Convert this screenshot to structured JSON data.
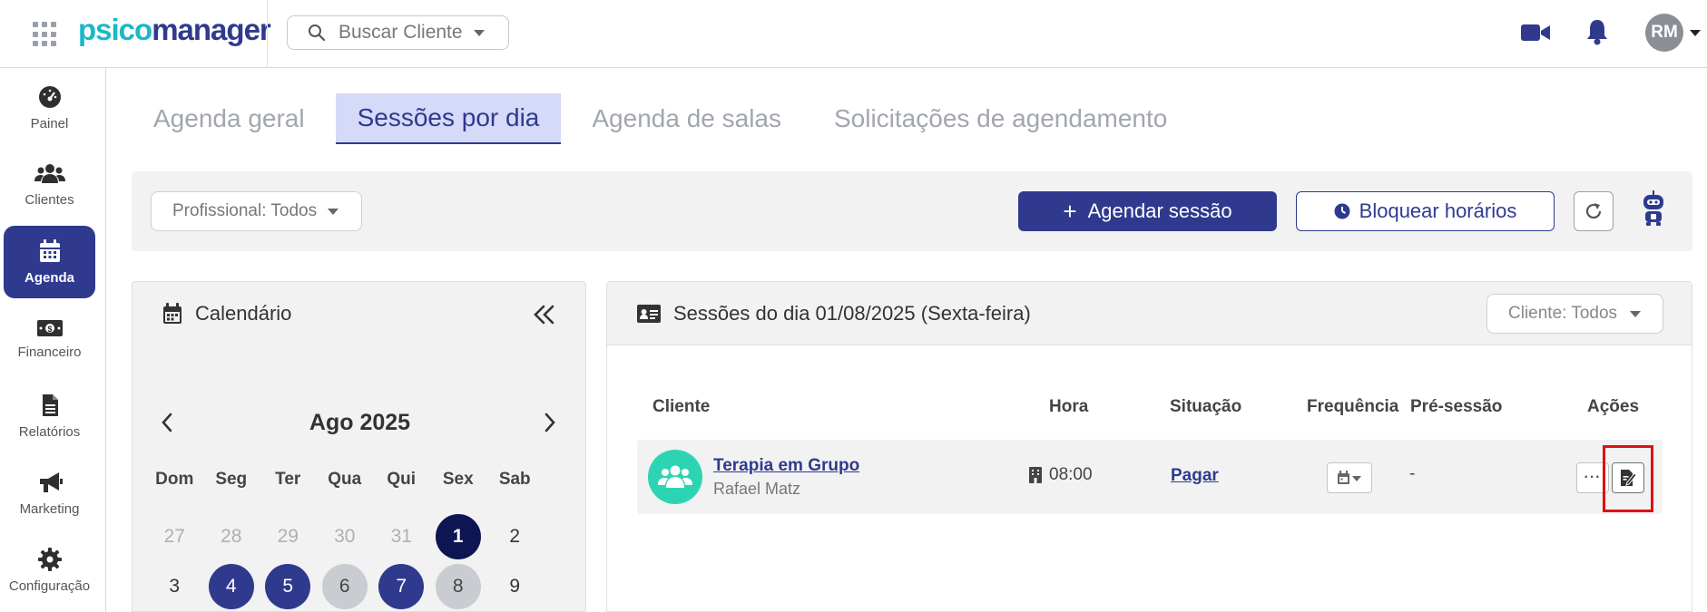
{
  "header": {
    "logo_part1": "psico",
    "logo_part2": "manager",
    "search_placeholder": "Buscar Cliente",
    "avatar_initials": "RM",
    "icons": [
      "apps-grid-icon",
      "search-icon",
      "video-camera-icon",
      "bell-icon"
    ]
  },
  "sidebar": {
    "items": [
      {
        "label": "Painel",
        "icon": "dashboard-gauge-icon"
      },
      {
        "label": "Clientes",
        "icon": "users-icon"
      },
      {
        "label": "Agenda",
        "icon": "calendar-icon",
        "active": true
      },
      {
        "label": "Financeiro",
        "icon": "money-icon"
      },
      {
        "label": "Relatórios",
        "icon": "document-icon"
      },
      {
        "label": "Marketing",
        "icon": "megaphone-icon"
      },
      {
        "label": "Configuração",
        "icon": "gear-icon"
      }
    ]
  },
  "tabs": [
    {
      "label": "Agenda geral"
    },
    {
      "label": "Sessões por dia",
      "active": true
    },
    {
      "label": "Agenda de salas"
    },
    {
      "label": "Solicitações de agendamento"
    }
  ],
  "toolbar": {
    "professional_filter": "Profissional: Todos",
    "schedule_button": "Agendar sessão",
    "block_button": "Bloquear horários"
  },
  "calendar": {
    "title": "Calendário",
    "month_label": "Ago 2025",
    "weekdays": [
      "Dom",
      "Seg",
      "Ter",
      "Qua",
      "Qui",
      "Sex",
      "Sab"
    ],
    "days": [
      {
        "n": "27",
        "state": "out"
      },
      {
        "n": "28",
        "state": "out"
      },
      {
        "n": "29",
        "state": "out"
      },
      {
        "n": "30",
        "state": "out"
      },
      {
        "n": "31",
        "state": "out"
      },
      {
        "n": "1",
        "state": "today"
      },
      {
        "n": "2",
        "state": "normal"
      },
      {
        "n": "3",
        "state": "normal"
      },
      {
        "n": "4",
        "state": "booked"
      },
      {
        "n": "5",
        "state": "booked"
      },
      {
        "n": "6",
        "state": "grey"
      },
      {
        "n": "7",
        "state": "booked"
      },
      {
        "n": "8",
        "state": "grey"
      },
      {
        "n": "9",
        "state": "normal"
      }
    ]
  },
  "sessions": {
    "title": "Sessões do dia 01/08/2025 (Sexta-feira)",
    "client_filter": "Cliente: Todos",
    "columns": {
      "cliente": "Cliente",
      "hora": "Hora",
      "situacao": "Situação",
      "frequencia": "Frequência",
      "pre_sessao": "Pré-sessão",
      "acoes": "Ações"
    },
    "rows": [
      {
        "client_name": "Terapia em Grupo",
        "professional": "Rafael Matz",
        "time": "08:00",
        "status": "Pagar",
        "pre_session": "-",
        "more": "···"
      }
    ]
  },
  "colors": {
    "primary": "#2f3a8f",
    "accent": "#1bb8c9",
    "highlight": "#e01010",
    "group_avatar": "#2dd4b4"
  }
}
